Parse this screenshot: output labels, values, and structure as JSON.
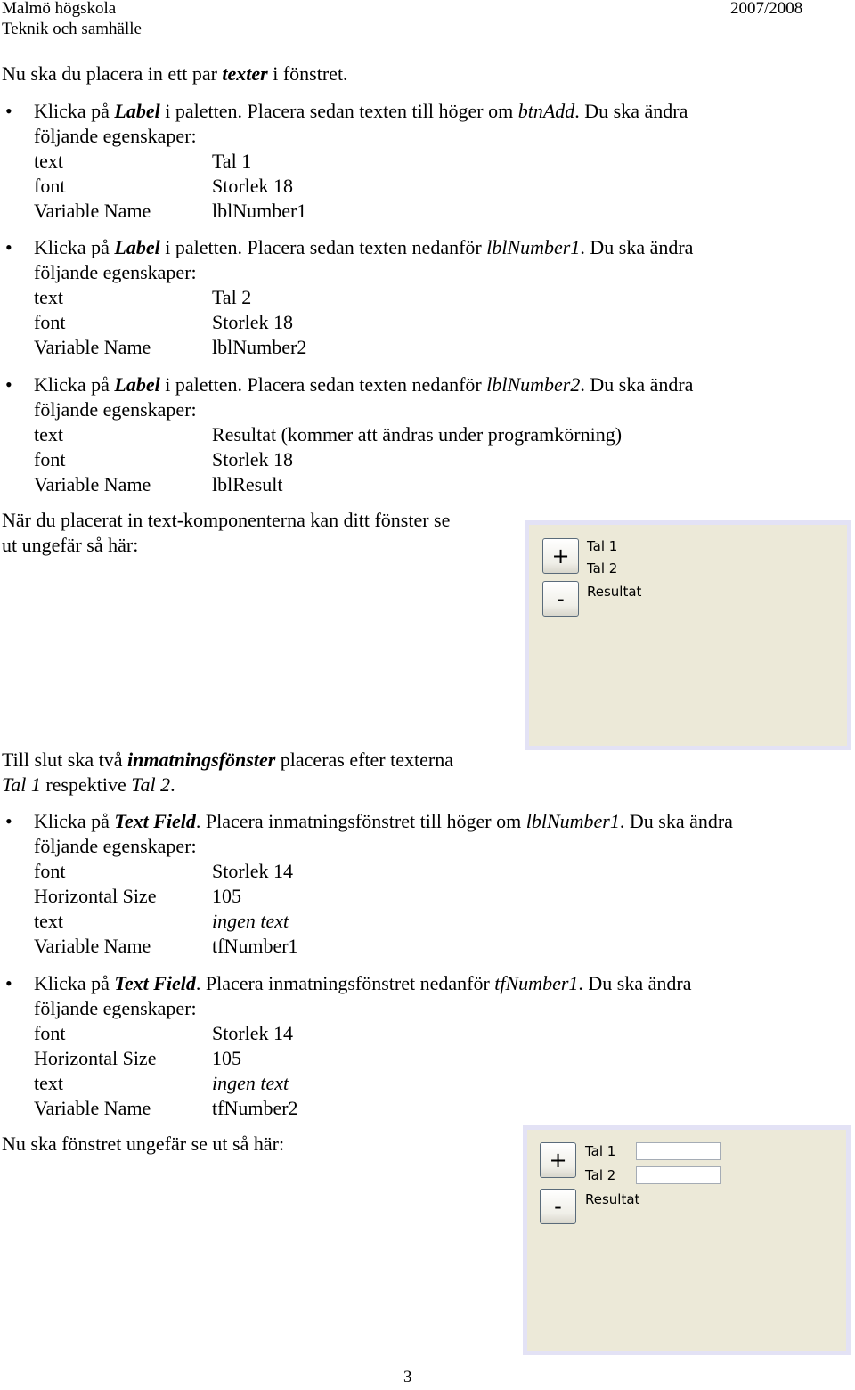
{
  "header": {
    "school": "Malmö högskola",
    "department": "Teknik och samhälle",
    "year": "2007/2008"
  },
  "intro": {
    "pre": "Nu ska du placera in ett par ",
    "em": "texter",
    "post": " i fönstret."
  },
  "steps_labels": [
    {
      "bullet": "•",
      "pre": "Klicka på ",
      "em": "Label",
      "mid": " i paletten. Placera sedan texten till höger om ",
      "ref": "btnAdd",
      "post": ". Du ska ändra",
      "line2": "följande egenskaper:",
      "props": [
        {
          "key": "text",
          "value": "Tal 1"
        },
        {
          "key": "font",
          "value": "Storlek 18"
        },
        {
          "key": "Variable Name",
          "value": "lblNumber1"
        }
      ]
    },
    {
      "bullet": "•",
      "pre": "Klicka på ",
      "em": "Label",
      "mid": " i paletten. Placera sedan texten nedanför ",
      "ref": "lblNumber1",
      "post": ". Du ska ändra",
      "line2": "följande egenskaper:",
      "props": [
        {
          "key": "text",
          "value": "Tal 2"
        },
        {
          "key": "font",
          "value": "Storlek 18"
        },
        {
          "key": "Variable Name",
          "value": "lblNumber2"
        }
      ]
    },
    {
      "bullet": "•",
      "pre": "Klicka på ",
      "em": "Label",
      "mid": " i paletten. Placera sedan texten nedanför ",
      "ref": "lblNumber2",
      "post": ". Du ska ändra",
      "line2": "följande egenskaper:",
      "props": [
        {
          "key": "text",
          "value": "Resultat (kommer att ändras under programkörning)"
        },
        {
          "key": "font",
          "value": "Storlek 18"
        },
        {
          "key": "Variable Name",
          "value": "lblResult"
        }
      ]
    }
  ],
  "after_labels": {
    "line1": "När du placerat in text-komponenterna kan ditt fönster se",
    "line2": "ut ungefär så här:"
  },
  "screenshot1": {
    "add_button": "+",
    "sub_button": "-",
    "label1": "Tal 1",
    "label2": "Tal 2",
    "label3": "Resultat",
    "bg_color": "#ece9d8"
  },
  "fields_intro": {
    "pre": "Till slut ska två ",
    "em": "inmatningsfönster",
    "post": " placeras efter texterna",
    "l2_a": "Tal 1",
    "l2_mid": " respektive ",
    "l2_b": "Tal 2",
    "l2_end": "."
  },
  "steps_fields": [
    {
      "bullet": "•",
      "pre": "Klicka på ",
      "em": "Text Field",
      "mid": ". Placera inmatningsfönstret till höger om ",
      "ref": "lblNumber1",
      "post": ". Du ska ändra",
      "line2": "följande egenskaper:",
      "props": [
        {
          "key": "font",
          "value": "Storlek 14"
        },
        {
          "key": "Horizontal Size",
          "value": "105"
        },
        {
          "key": "text",
          "value": "ingen text"
        },
        {
          "key": "Variable Name",
          "value": "tfNumber1"
        }
      ]
    },
    {
      "bullet": "•",
      "pre": "Klicka på ",
      "em": "Text Field",
      "mid": ". Placera inmatningsfönstret nedanför ",
      "ref": "tfNumber1",
      "post": ". Du ska ändra",
      "line2": "följande egenskaper:",
      "props": [
        {
          "key": "font",
          "value": "Storlek 14"
        },
        {
          "key": "Horizontal Size",
          "value": "105"
        },
        {
          "key": "text",
          "value": "ingen text"
        },
        {
          "key": "Variable Name",
          "value": "tfNumber2"
        }
      ]
    }
  ],
  "final": {
    "text": "Nu ska fönstret ungefär se ut så här:"
  },
  "screenshot2": {
    "add_button": "+",
    "sub_button": "-",
    "label1": "Tal 1",
    "label2": "Tal 2",
    "label3": "Resultat",
    "field1_value": "",
    "field2_value": ""
  },
  "page_number": "3"
}
